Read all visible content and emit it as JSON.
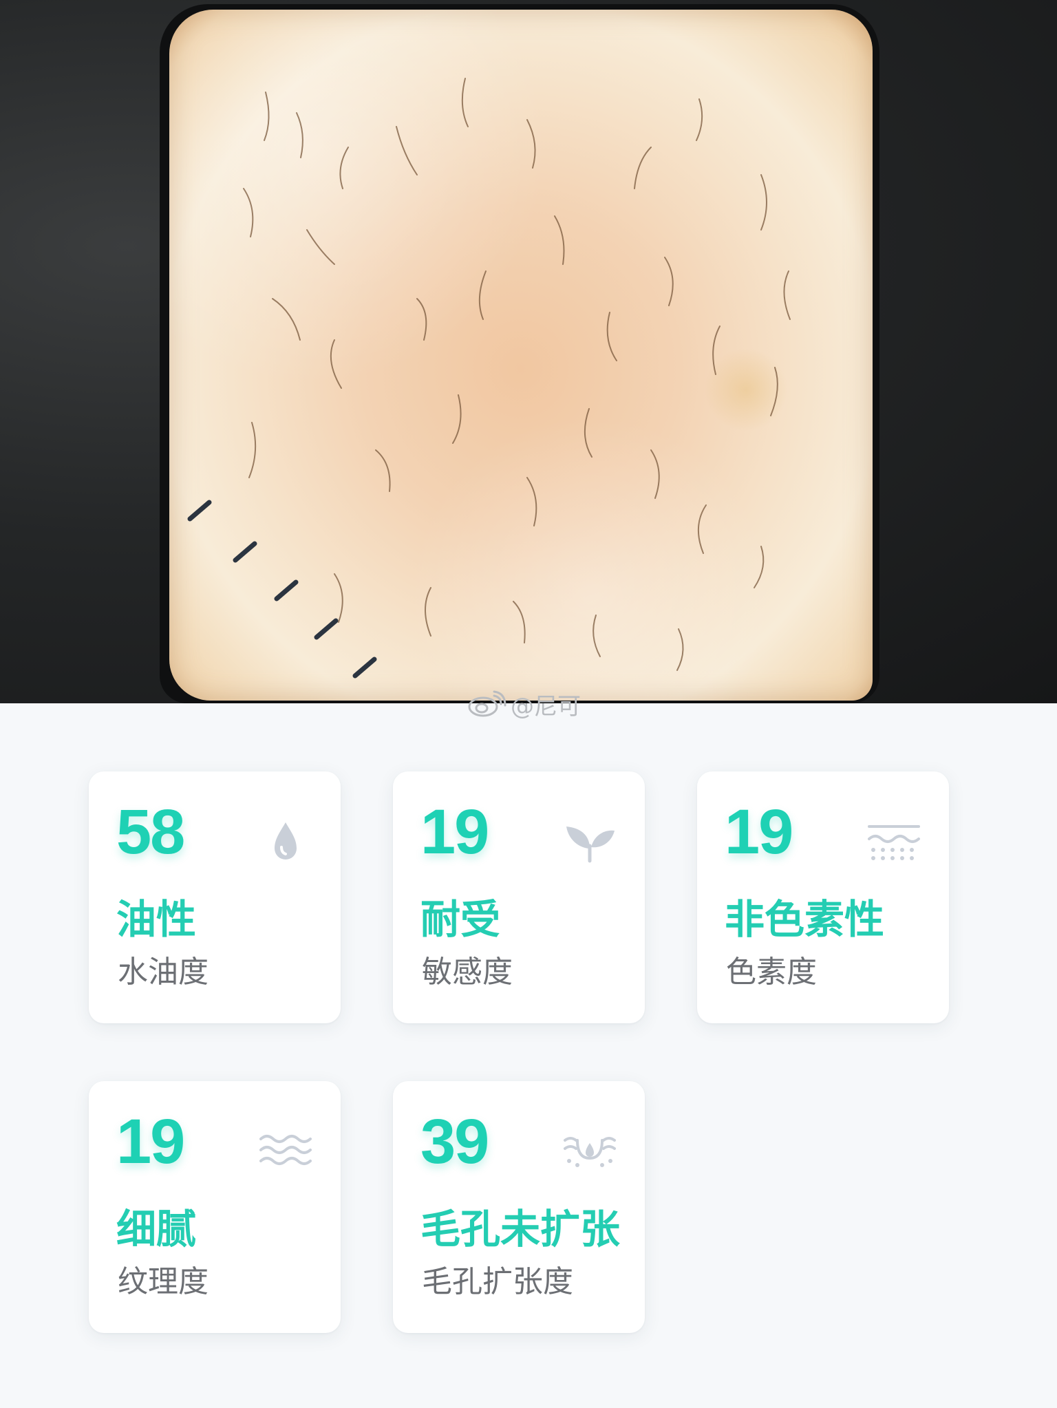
{
  "watermark": {
    "text": "@尼可",
    "icon": "weibo-icon"
  },
  "metrics": [
    {
      "value": "58",
      "label": "油性",
      "sub": "水油度",
      "icon": "drop-icon"
    },
    {
      "value": "19",
      "label": "耐受",
      "sub": "敏感度",
      "icon": "leaf-icon"
    },
    {
      "value": "19",
      "label": "非色素性",
      "sub": "色素度",
      "icon": "pigment-icon"
    },
    {
      "value": "19",
      "label": "细腻",
      "sub": "纹理度",
      "icon": "waves-icon"
    },
    {
      "value": "39",
      "label": "毛孔未扩张",
      "sub": "毛孔扩张度",
      "icon": "pore-icon"
    }
  ],
  "colors": {
    "accent": "#1ed1b4",
    "sub_text": "#6c6f74",
    "icon": "#c9cfd8",
    "background": "#f6f8fa"
  }
}
